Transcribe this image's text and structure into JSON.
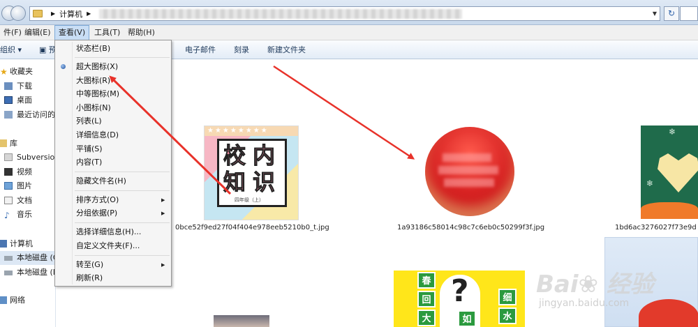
{
  "address_bar": {
    "breadcrumb": [
      "计算机"
    ]
  },
  "menubar": {
    "items": [
      {
        "label": "件(F)"
      },
      {
        "label": "编辑(E)"
      },
      {
        "label": "查看(V)"
      },
      {
        "label": "工具(T)"
      },
      {
        "label": "帮助(H)"
      }
    ]
  },
  "toolbar": {
    "organize": "组织",
    "preview": "预",
    "email": "电子邮件",
    "burn": "刻录",
    "new_folder": "新建文件夹"
  },
  "sidebar": {
    "items": [
      {
        "label": "收藏夹",
        "icon": "star-icon"
      },
      {
        "label": "下载",
        "icon": "download-folder-icon"
      },
      {
        "label": "桌面",
        "icon": "desktop-icon"
      },
      {
        "label": "最近访问的",
        "icon": "recent-places-icon"
      },
      {
        "label": "库",
        "icon": "library-icon"
      },
      {
        "label": "Subversion",
        "icon": "subversion-icon"
      },
      {
        "label": "视频",
        "icon": "video-icon"
      },
      {
        "label": "图片",
        "icon": "picture-icon"
      },
      {
        "label": "文档",
        "icon": "document-icon"
      },
      {
        "label": "音乐",
        "icon": "music-icon"
      },
      {
        "label": "计算机",
        "icon": "computer-icon"
      },
      {
        "label": "本地磁盘 (C",
        "icon": "disk-icon"
      },
      {
        "label": "本地磁盘 (D",
        "icon": "disk-icon"
      },
      {
        "label": "网络",
        "icon": "network-icon"
      }
    ]
  },
  "view_menu": {
    "items": [
      {
        "label": "状态栏(B)"
      },
      {
        "label": "超大图标(X)"
      },
      {
        "label": "大图标(R)"
      },
      {
        "label": "中等图标(M)"
      },
      {
        "label": "小图标(N)"
      },
      {
        "label": "列表(L)"
      },
      {
        "label": "详细信息(D)"
      },
      {
        "label": "平铺(S)"
      },
      {
        "label": "内容(T)"
      },
      {
        "label": "隐藏文件名(H)"
      },
      {
        "label": "排序方式(O)"
      },
      {
        "label": "分组依据(P)"
      },
      {
        "label": "选择详细信息(H)..."
      },
      {
        "label": "自定义文件夹(F)..."
      },
      {
        "label": "转至(G)"
      },
      {
        "label": "刷新(R)"
      }
    ],
    "selected": "超大图标(X)"
  },
  "files": [
    {
      "name": "0bce52f9ed27f04f404e978eeb5210b0_t.jpg"
    },
    {
      "name": "1a93186c58014c98c7c6eb0c50299f3f.jpg"
    },
    {
      "name": "1bd6ac3276027f73e9d"
    }
  ],
  "thumb1": {
    "text": [
      "校",
      "内",
      "知",
      "识"
    ],
    "caption": "四年级（上）"
  },
  "thumb4": {
    "cells": [
      "春",
      "回",
      "大",
      "细",
      "水",
      "如"
    ]
  },
  "watermark": {
    "brand": "Bai",
    "brand_cn": "经验",
    "url": "jingyan.baidu.com"
  },
  "colors": {
    "arrow": "#e8322a",
    "menu_highlight": "#c9def5"
  }
}
